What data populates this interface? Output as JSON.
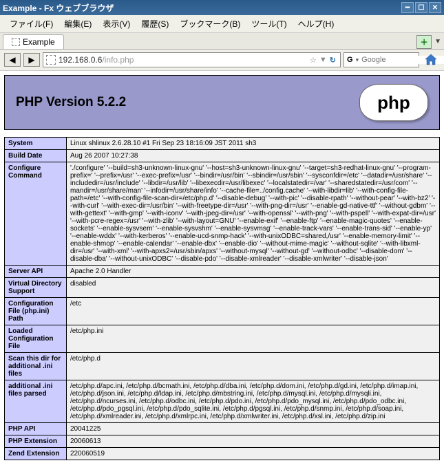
{
  "window": {
    "title": "Example - Fx ウェブブラウザ"
  },
  "menu": {
    "file": "ファイル(F)",
    "edit": "編集(E)",
    "view": "表示(V)",
    "history": "履歴(S)",
    "bookmarks": "ブックマーク(B)",
    "tools": "ツール(T)",
    "help": "ヘルプ(H)"
  },
  "tabs": {
    "active_label": "Example"
  },
  "urlbar": {
    "host": "192.168.0.6",
    "path": "/info.php",
    "star_label": "☆",
    "dropdown_label": "▼"
  },
  "search": {
    "engine_icon": "G",
    "placeholder": "Google"
  },
  "phpinfo": {
    "header": "PHP Version 5.2.2",
    "logo_text": "php",
    "rows": {
      "system": {
        "key": "System",
        "value": "Linux shlinux 2.6.28.10 #1 Fri Sep 23 18:16:09 JST 2011 sh3"
      },
      "build_date": {
        "key": "Build Date",
        "value": "Aug 26 2007 10:27:38"
      },
      "configure_command": {
        "key": "Configure Command",
        "value": "'./configure' '--build=sh3-unknown-linux-gnu' '--host=sh3-unknown-linux-gnu' '--target=sh3-redhat-linux-gnu' '--program-prefix=' '--prefix=/usr' '--exec-prefix=/usr' '--bindir=/usr/bin' '--sbindir=/usr/sbin' '--sysconfdir=/etc' '--datadir=/usr/share' '--includedir=/usr/include' '--libdir=/usr/lib' '--libexecdir=/usr/libexec' '--localstatedir=/var' '--sharedstatedir=/usr/com' '--mandir=/usr/share/man' '--infodir=/usr/share/info' '--cache-file=../config.cache' '--with-libdir=lib' '--with-config-file-path=/etc' '--with-config-file-scan-dir=/etc/php.d' '--disable-debug' '--with-pic' '--disable-rpath' '--without-pear' '--with-bz2' '--with-curl' '--with-exec-dir=/usr/bin' '--with-freetype-dir=/usr' '--with-png-dir=/usr' '--enable-gd-native-ttf' '--without-gdbm' '--with-gettext' '--with-gmp' '--with-iconv' '--with-jpeg-dir=/usr' '--with-openssl' '--with-png' '--with-pspell' '--with-expat-dir=/usr' '--with-pcre-regex=/usr' '--with-zlib' '--with-layout=GNU' '--enable-exif' '--enable-ftp' '--enable-magic-quotes' '--enable-sockets' '--enable-sysvsem' '--enable-sysvshm' '--enable-sysvmsg' '--enable-track-vars' '--enable-trans-sid' '--enable-yp' '--enable-wddx' '--with-kerberos' '--enable-ucd-snmp-hack' '--with-unixODBC=shared,/usr' '--enable-memory-limit' '--enable-shmop' '--enable-calendar' '--enable-dbx' '--enable-dio' '--without-mime-magic' '--without-sqlite' '--with-libxml-dir=/usr' '--with-xml' '--with-apxs2=/usr/sbin/apxs' '--without-mysql' '--without-gd' '--without-odbc' '--disable-dom' '--disable-dba' '--without-unixODBC' '--disable-pdo' '--disable-xmlreader' '--disable-xmlwriter' '--disable-json'"
      },
      "server_api": {
        "key": "Server API",
        "value": "Apache 2.0 Handler"
      },
      "virtual_directory_support": {
        "key": "Virtual Directory Support",
        "value": "disabled"
      },
      "config_file_path": {
        "key": "Configuration File (php.ini) Path",
        "value": "/etc"
      },
      "loaded_config_file": {
        "key": "Loaded Configuration File",
        "value": "/etc/php.ini"
      },
      "scan_dir": {
        "key": "Scan this dir for additional .ini files",
        "value": "/etc/php.d"
      },
      "additional_ini": {
        "key": "additional .ini files parsed",
        "value": "/etc/php.d/apc.ini, /etc/php.d/bcmath.ini, /etc/php.d/dba.ini, /etc/php.d/dom.ini, /etc/php.d/gd.ini, /etc/php.d/imap.ini, /etc/php.d/json.ini, /etc/php.d/ldap.ini, /etc/php.d/mbstring.ini, /etc/php.d/mysql.ini, /etc/php.d/mysqli.ini, /etc/php.d/ncurses.ini, /etc/php.d/odbc.ini, /etc/php.d/pdo.ini, /etc/php.d/pdo_mysql.ini, /etc/php.d/pdo_odbc.ini, /etc/php.d/pdo_pgsql.ini, /etc/php.d/pdo_sqlite.ini, /etc/php.d/pgsql.ini, /etc/php.d/snmp.ini, /etc/php.d/soap.ini, /etc/php.d/xmlreader.ini, /etc/php.d/xmlrpc.ini, /etc/php.d/xmlwriter.ini, /etc/php.d/xsl.ini, /etc/php.d/zip.ini"
      },
      "php_api": {
        "key": "PHP API",
        "value": "20041225"
      },
      "php_extension": {
        "key": "PHP Extension",
        "value": "20060613"
      },
      "zend_extension": {
        "key": "Zend Extension",
        "value": "220060519"
      }
    }
  }
}
